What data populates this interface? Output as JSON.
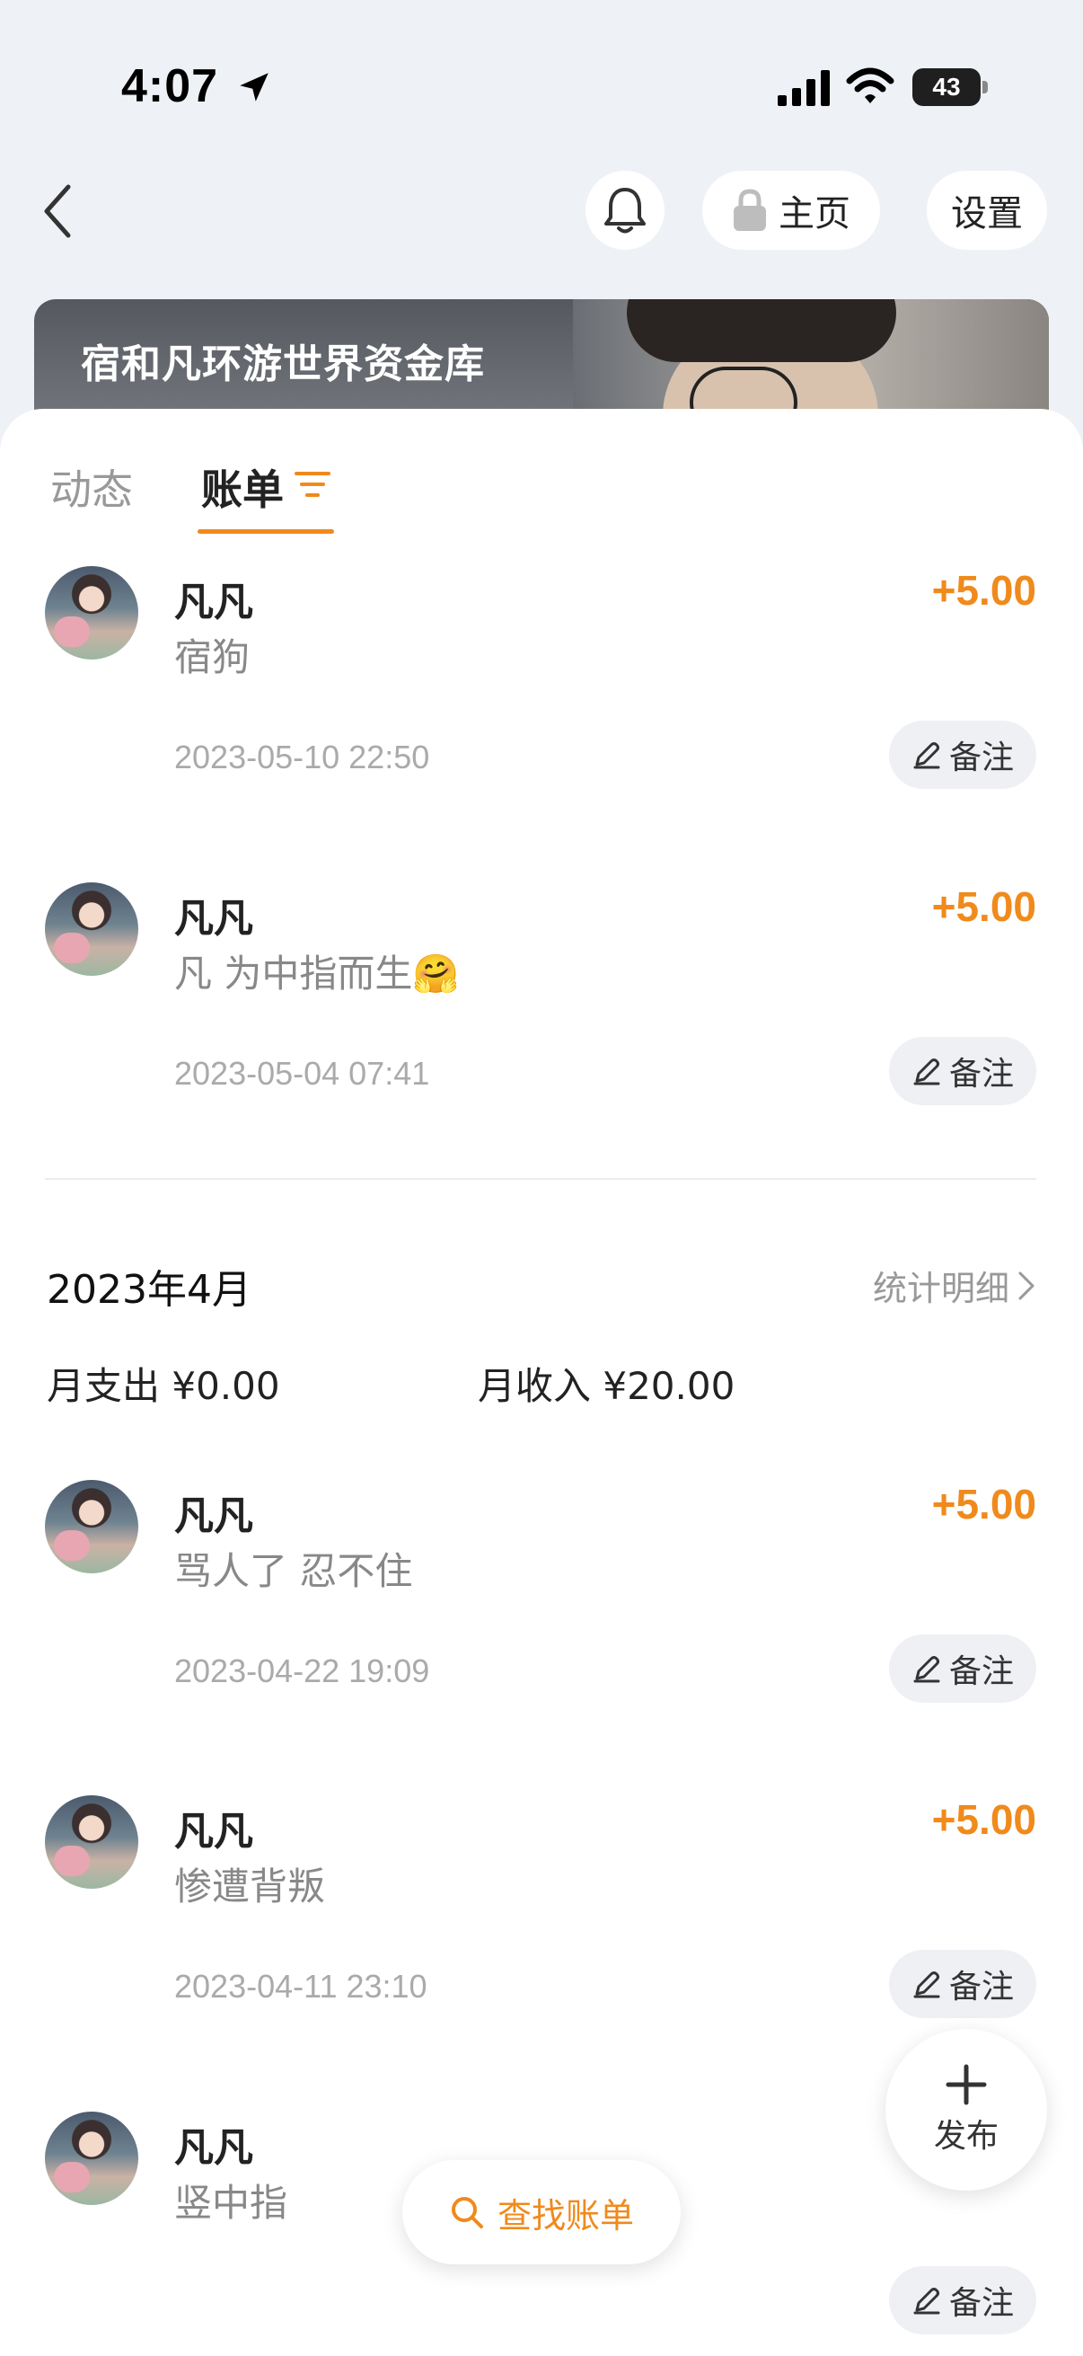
{
  "status_bar": {
    "time": "4:07",
    "battery": "43"
  },
  "nav": {
    "home_label": "主页",
    "settings_label": "设置"
  },
  "banner": {
    "title": "宿和凡环游世界资金库"
  },
  "tabs": {
    "dynamic": "动态",
    "bill": "账单"
  },
  "records_may": [
    {
      "name": "凡凡",
      "note": "宿狗",
      "amount": "+5.00",
      "datetime": "2023-05-10 22:50",
      "remark_label": "备注"
    },
    {
      "name": "凡凡",
      "note": "凡 为中指而生🤗",
      "amount": "+5.00",
      "datetime": "2023-05-04 07:41",
      "remark_label": "备注"
    }
  ],
  "month_april": {
    "title": "2023年4月",
    "stats_link": "统计明细",
    "expense": "月支出 ¥0.00",
    "income": "月收入 ¥20.00"
  },
  "records_april": [
    {
      "name": "凡凡",
      "note": "骂人了 忍不住",
      "amount": "+5.00",
      "datetime": "2023-04-22 19:09",
      "remark_label": "备注"
    },
    {
      "name": "凡凡",
      "note": "惨遭背叛",
      "amount": "+5.00",
      "datetime": "2023-04-11 23:10",
      "remark_label": "备注"
    },
    {
      "name": "凡凡",
      "note": "竖中指",
      "amount": "",
      "datetime": "",
      "remark_label": "备注"
    }
  ],
  "floating": {
    "publish_label": "发布",
    "search_label": "查找账单"
  },
  "colors": {
    "accent": "#f08a1c",
    "background": "#eef1f6"
  }
}
